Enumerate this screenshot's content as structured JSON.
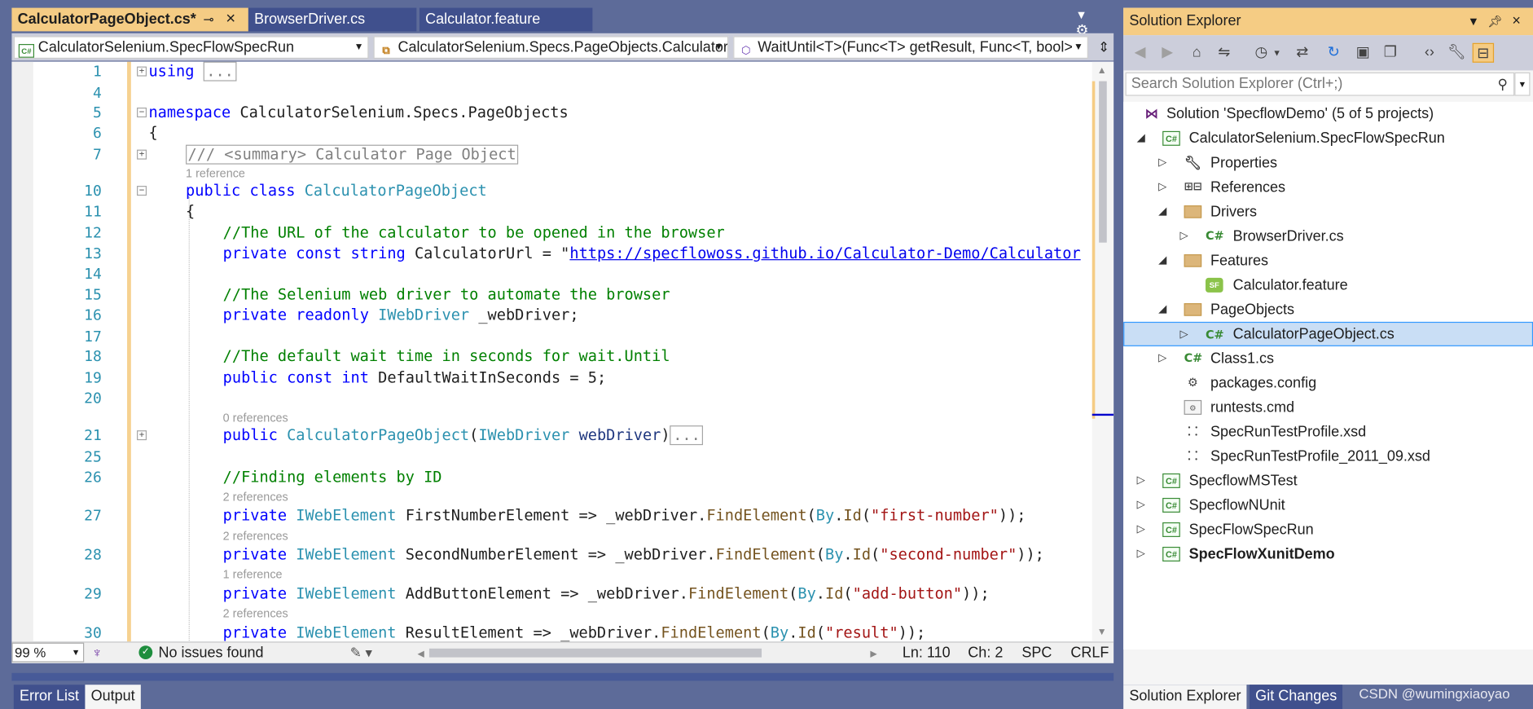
{
  "tabs": {
    "active": "CalculatorPageObject.cs*",
    "second": "BrowserDriver.cs",
    "third": "Calculator.feature"
  },
  "navbar": {
    "project": "CalculatorSelenium.SpecFlowSpecRun",
    "type": "CalculatorSelenium.Specs.PageObjects.Calculator",
    "member": "WaitUntil<T>(Func<T> getResult, Func<T, bool>"
  },
  "code": {
    "ln1": "1",
    "ln4": "4",
    "ln5": "5",
    "ln6": "6",
    "ln7": "7",
    "ln10": "10",
    "ln11": "11",
    "ln12": "12",
    "ln13": "13",
    "ln14": "14",
    "ln15": "15",
    "ln16": "16",
    "ln17": "17",
    "ln18": "18",
    "ln19": "19",
    "ln20": "20",
    "ln21": "21",
    "ln25": "25",
    "ln26": "26",
    "ln27": "27",
    "ln28": "28",
    "ln29": "29",
    "ln30": "30",
    "using_kw": "using",
    "collapsed": "...",
    "namespace_kw": "namespace",
    "namespace_name": " CalculatorSelenium.Specs.PageObjects",
    "open_brace": "{",
    "summary": "/// <summary> Calculator Page Object",
    "lens_1ref": "1 reference",
    "public_kw": "public",
    "class_kw": "class",
    "class_name": "CalculatorPageObject",
    "comment_url": "//The URL of the calculator to be opened in the browser",
    "private_kw": "private",
    "const_kw": "const",
    "string_kw": "string",
    "calc_url_decl": " CalculatorUrl = \"",
    "calc_url": "https://specflowoss.github.io/Calculator-Demo/Calculator",
    "comment_driver": "//The Selenium web driver to automate the browser",
    "readonly_kw": "readonly",
    "iwebdriver": "IWebDriver",
    "webdriver_field": " _webDriver;",
    "comment_wait": "//The default wait time in seconds for wait.Until",
    "int_kw": "int",
    "wait_decl": " DefaultWaitInSeconds = 5;",
    "lens_0refs": "0 references",
    "ctor_name": "CalculatorPageObject",
    "ctor_open": "(",
    "ctor_param": "webDriver",
    "ctor_close": ")",
    "comment_find": "//Finding elements by ID",
    "lens_2refs": "2 references",
    "iwebelement": "IWebElement",
    "first_name": " FirstNumberElement => _webDriver.",
    "second_name": " SecondNumberElement => _webDriver.",
    "add_name": " AddButtonElement => _webDriver.",
    "result_name": " ResultElement => _webDriver.",
    "findelement": "FindElement",
    "by": "By",
    "dot": ".",
    "id": "Id",
    "paren_open": "(",
    "first_id": "\"first-number\"",
    "second_id": "\"second-number\"",
    "add_id": "\"add-button\"",
    "result_id": "\"result\"",
    "close": "));"
  },
  "status": {
    "zoom": "99 %",
    "issues": "No issues found",
    "line": "Ln: 110",
    "char": "Ch: 2",
    "spc": "SPC",
    "crlf": "CRLF"
  },
  "bottom_tabs": {
    "error_list": "Error List",
    "output": "Output"
  },
  "solution_explorer": {
    "title": "Solution Explorer",
    "search_placeholder": "Search Solution Explorer (Ctrl+;)",
    "items": [
      "Solution 'SpecflowDemo' (5 of 5 projects)",
      "CalculatorSelenium.SpecFlowSpecRun",
      "Properties",
      "References",
      "Drivers",
      "BrowserDriver.cs",
      "Features",
      "Calculator.feature",
      "PageObjects",
      "CalculatorPageObject.cs",
      "Class1.cs",
      "packages.config",
      "runtests.cmd",
      "SpecRunTestProfile.xsd",
      "SpecRunTestProfile_2011_09.xsd",
      "SpecflowMSTest",
      "SpecflowNUnit",
      "SpecFlowSpecRun",
      "SpecFlowXunitDemo"
    ],
    "bottom_tabs": [
      "Solution Explorer",
      "Git Changes"
    ]
  },
  "watermark": "CSDN @wumingxiaoyao",
  "colors": {
    "accent": "#f5cc84",
    "chrome": "#5d6b99",
    "keyword": "#0000ff",
    "type": "#2b91af",
    "comment": "#008000",
    "string": "#a31515"
  }
}
